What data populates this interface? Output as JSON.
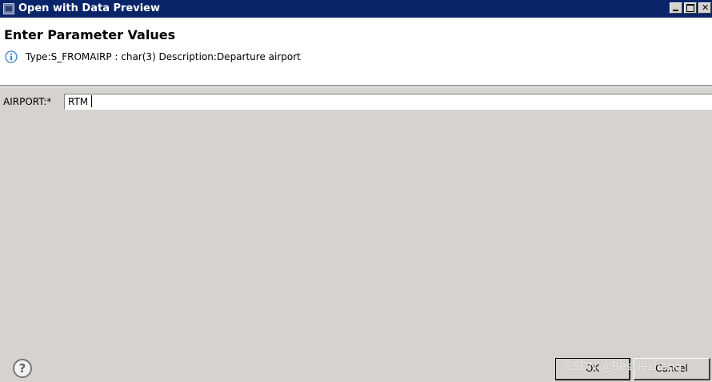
{
  "window": {
    "title": "Open with Data Preview"
  },
  "header": {
    "title": "Enter Parameter Values",
    "info_text": "Type:S_FROMAIRP : char(3) Description:Departure airport"
  },
  "parameter": {
    "label": "AIRPORT:*",
    "value": "RTM"
  },
  "buttons": {
    "help_label": "?",
    "ok_label": "OK",
    "cancel_label": "Cancel"
  },
  "watermark": "CSDN @Bessiezhang",
  "colors": {
    "titlebar": "#0a246a",
    "dialog_bg": "#d6d3ce",
    "info_icon": "#3a7bd5"
  },
  "icons": {
    "window": "app-window-icon",
    "info": "info-icon",
    "help": "help-icon"
  }
}
